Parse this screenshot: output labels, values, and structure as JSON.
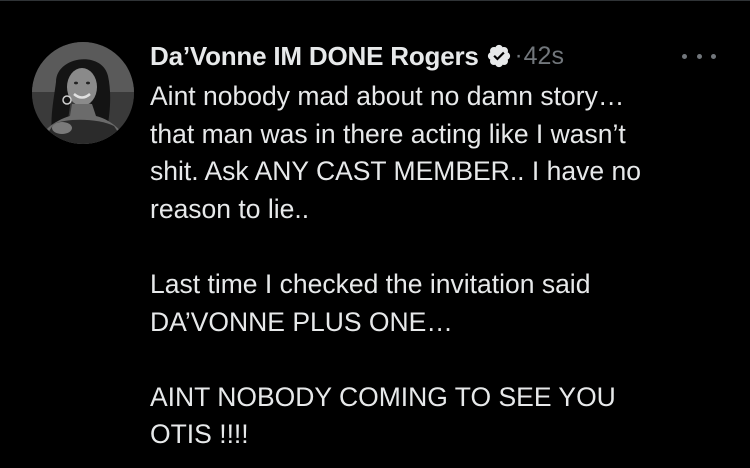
{
  "tweet": {
    "author": {
      "display_name": "Da’Vonne IM DONE Rogers",
      "verified_icon": "verified-badge-icon",
      "avatar_icon": "profile-photo"
    },
    "separator": "·",
    "timestamp": "42s",
    "more_icon": "more-horizontal-icon",
    "paragraphs": [
      {
        "lines": [
          "Aint nobody mad about no damn story…",
          "that man was in there acting like I wasn’t",
          "shit. Ask ANY CAST MEMBER.. I have no",
          "reason to lie.."
        ]
      },
      {
        "lines": [
          "Last time I checked the invitation said",
          "DA’VONNE PLUS ONE…"
        ]
      },
      {
        "lines": [
          "AINT NOBODY COMING TO SEE YOU",
          "OTIS !!!!"
        ]
      }
    ]
  },
  "colors": {
    "background": "#000000",
    "primary_text": "#e7e9ea",
    "secondary_text": "#71767b",
    "divider": "#2f3336"
  }
}
